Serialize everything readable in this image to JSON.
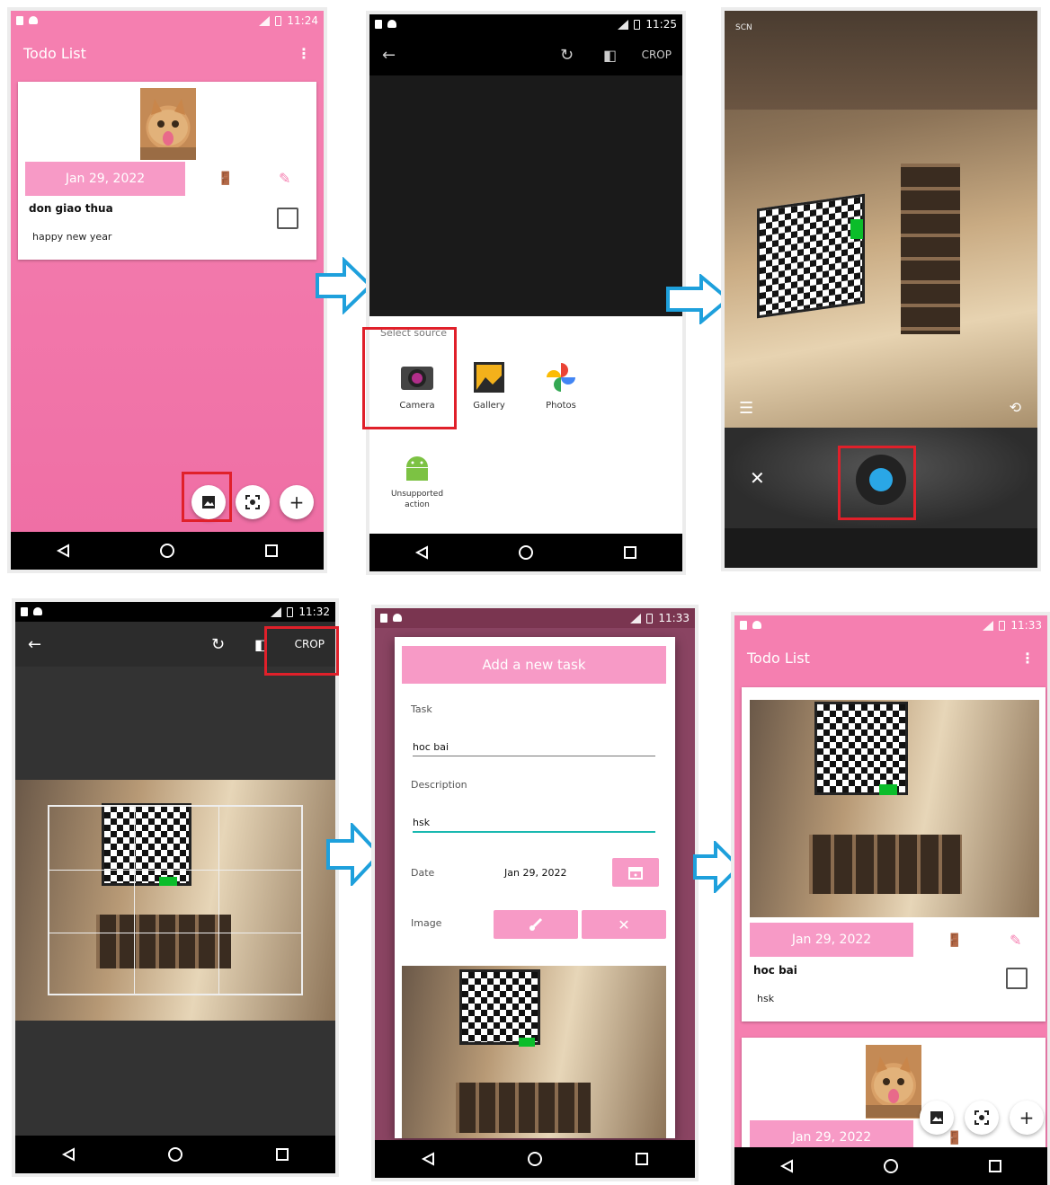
{
  "colors": {
    "brand_pink": "#f57fb0",
    "date_pink": "#f79ac6",
    "highlight_red": "#e0202a",
    "arrow_blue": "#1ea0dc",
    "shutter_blue": "#2aa7e6"
  },
  "screen1": {
    "status_time": "11:24",
    "title": "Todo List",
    "menu_icon": "more-vert-icon",
    "date": "Jan 29, 2022",
    "task": "don giao thua",
    "description": "happy new year"
  },
  "screen2": {
    "status_time": "11:25",
    "crop_label": "CROP",
    "sheet_title": "Select source",
    "sources": [
      {
        "label": "Camera",
        "icon": "camera-icon"
      },
      {
        "label": "Gallery",
        "icon": "gallery-icon"
      },
      {
        "label": "Photos",
        "icon": "photos-pinwheel-icon"
      },
      {
        "label": "Unsupported\naction",
        "icon": "android-icon"
      }
    ]
  },
  "screen3": {
    "scene_label": "SCN",
    "close_glyph": "✕"
  },
  "screen4": {
    "status_time": "11:32",
    "crop_label": "CROP"
  },
  "screen5": {
    "status_time": "11:33",
    "dialog_title": "Add a new task",
    "task_label": "Task",
    "task_value": "hoc bai",
    "description_label": "Description",
    "description_value": "hsk",
    "date_label": "Date",
    "date_value": "Jan 29, 2022",
    "image_label": "Image"
  },
  "screen6": {
    "status_time": "11:33",
    "title": "Todo List",
    "date": "Jan 29, 2022",
    "task": "hoc bai",
    "description": "hsk",
    "date2": "Jan 29, 2022"
  }
}
